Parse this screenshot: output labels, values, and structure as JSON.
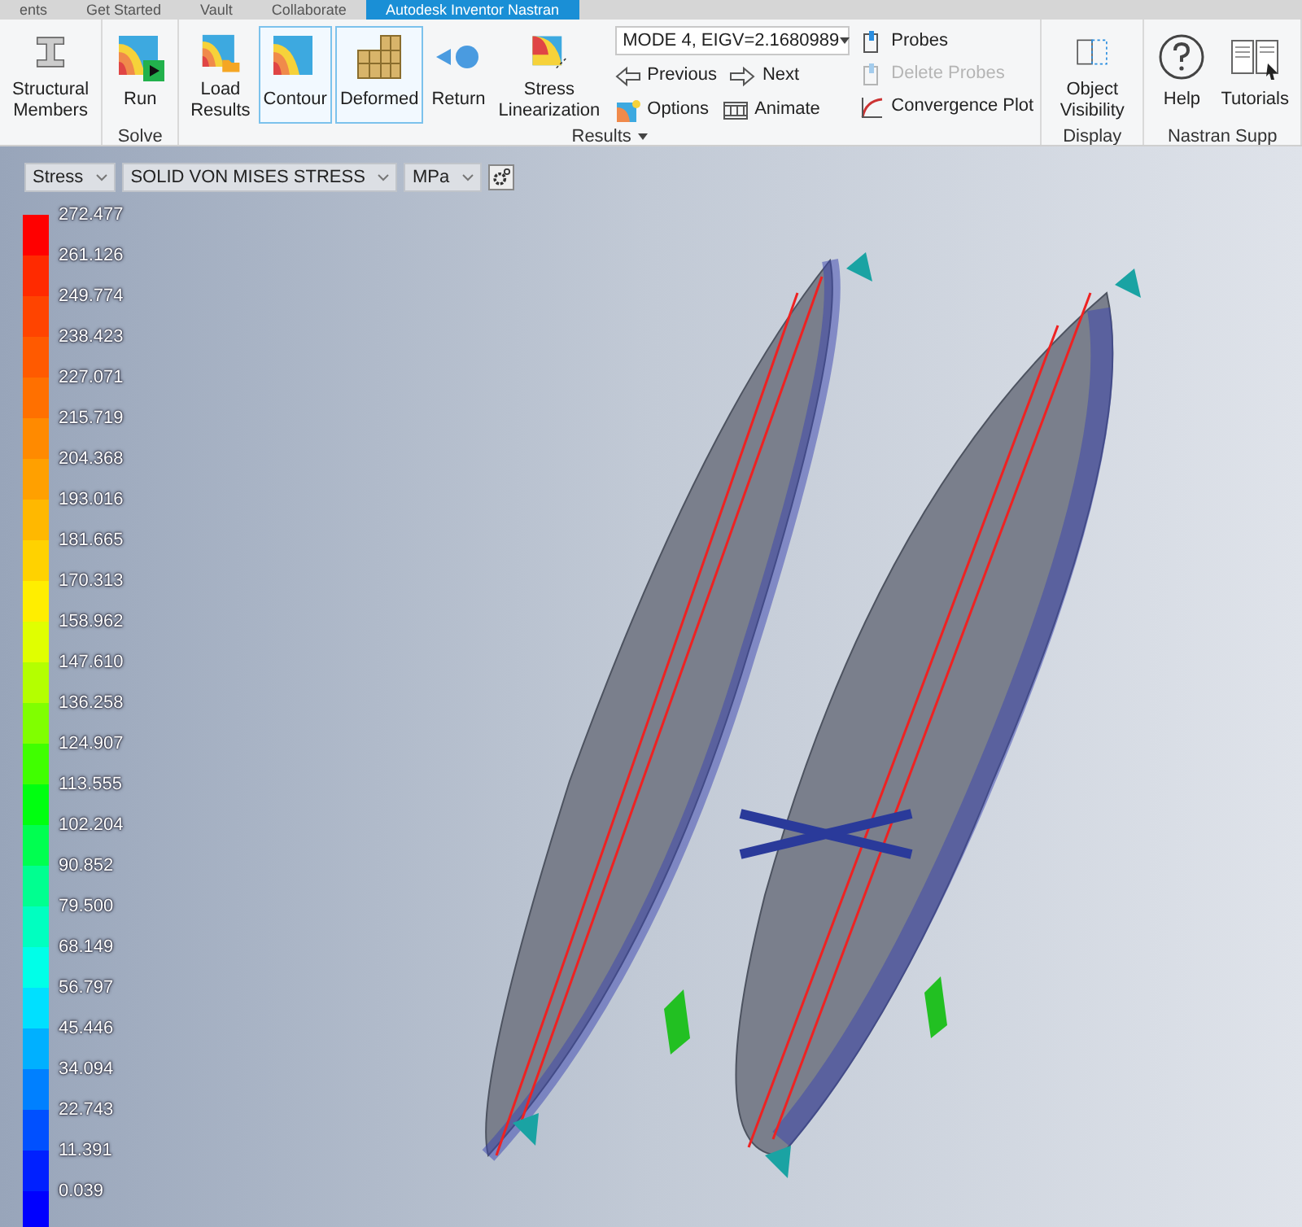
{
  "file_tabs": [
    {
      "label": "ents",
      "selected": false
    },
    {
      "label": "Get Started",
      "selected": false
    },
    {
      "label": "Vault",
      "selected": false
    },
    {
      "label": "Collaborate",
      "selected": false
    },
    {
      "label": "Autodesk Inventor Nastran",
      "selected": true
    }
  ],
  "ribbon": {
    "groups": [
      {
        "buttons": [
          {
            "label": "Structural Members",
            "kind": "beam",
            "selected": false
          }
        ]
      },
      {
        "title": "Solve",
        "buttons": [
          {
            "label": "Run",
            "kind": "run",
            "selected": false
          }
        ]
      },
      {
        "title": "Results",
        "has_menu": true,
        "buttons": [
          {
            "label": "Load Results",
            "kind": "load",
            "selected": false
          },
          {
            "label": "Contour",
            "kind": "contour",
            "selected": true
          },
          {
            "label": "Deformed",
            "kind": "deformed",
            "selected": true
          },
          {
            "label": "Return",
            "kind": "return",
            "selected": false
          },
          {
            "label": "Stress Linearization",
            "kind": "linear",
            "selected": false
          }
        ],
        "mode_dropdown": {
          "value": "MODE 4, EIGV=2.1680989"
        },
        "small_buttons": [
          [
            {
              "label": "Previous",
              "kind": "prev",
              "disabled": false
            },
            {
              "label": "Next",
              "kind": "next",
              "disabled": false
            }
          ],
          [
            {
              "label": "Options",
              "kind": "options",
              "disabled": false
            },
            {
              "label": "Animate",
              "kind": "animate",
              "disabled": false
            }
          ]
        ],
        "probe_buttons": [
          {
            "label": "Probes",
            "kind": "probe",
            "disabled": false
          },
          {
            "label": "Delete Probes",
            "kind": "probe",
            "disabled": true
          },
          {
            "label": "Convergence Plot",
            "kind": "plot",
            "disabled": false
          }
        ]
      },
      {
        "title": "Display",
        "buttons": [
          {
            "label": "Object Visibility",
            "kind": "visibility",
            "selected": false
          }
        ]
      },
      {
        "title": "Nastran Supp",
        "buttons": [
          {
            "label": "Help",
            "kind": "help",
            "selected": false
          },
          {
            "label": "Tutorials",
            "kind": "tutorials",
            "selected": false
          }
        ]
      }
    ]
  },
  "viewport": {
    "result_type": "Stress",
    "component": "SOLID VON MISES STRESS",
    "unit": "MPa",
    "legend": [
      {
        "value": "272.477",
        "color": "#ff0000"
      },
      {
        "value": "261.126",
        "color": "#ff2a00"
      },
      {
        "value": "249.774",
        "color": "#ff4400"
      },
      {
        "value": "238.423",
        "color": "#ff5a00"
      },
      {
        "value": "227.071",
        "color": "#ff7000"
      },
      {
        "value": "215.719",
        "color": "#ff8a00"
      },
      {
        "value": "204.368",
        "color": "#ffa000"
      },
      {
        "value": "193.016",
        "color": "#ffb800"
      },
      {
        "value": "181.665",
        "color": "#ffd200"
      },
      {
        "value": "170.313",
        "color": "#ffee00"
      },
      {
        "value": "158.962",
        "color": "#e0ff00"
      },
      {
        "value": "147.610",
        "color": "#b4ff00"
      },
      {
        "value": "136.258",
        "color": "#80ff00"
      },
      {
        "value": "124.907",
        "color": "#40ff00"
      },
      {
        "value": "113.555",
        "color": "#00ff10"
      },
      {
        "value": "102.204",
        "color": "#00ff50"
      },
      {
        "value": "90.852",
        "color": "#00ff90"
      },
      {
        "value": "79.500",
        "color": "#00ffc0"
      },
      {
        "value": "68.149",
        "color": "#00ffe8"
      },
      {
        "value": "56.797",
        "color": "#00e0ff"
      },
      {
        "value": "45.446",
        "color": "#00b0ff"
      },
      {
        "value": "34.094",
        "color": "#0080ff"
      },
      {
        "value": "22.743",
        "color": "#0050ff"
      },
      {
        "value": "11.391",
        "color": "#0020ff"
      },
      {
        "value": "0.039",
        "color": "#0000ff"
      }
    ]
  }
}
